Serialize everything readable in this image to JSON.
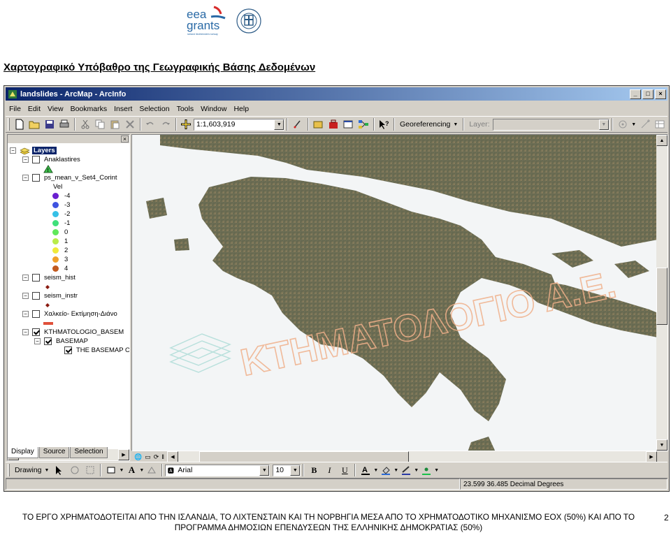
{
  "heading": "Χαρτογραφικό Υπόβαθρο της Γεωγραφικής Βάσης Δεδομένων",
  "logos": {
    "eea_line1": "eea",
    "eea_line2": "grants",
    "eea_tagline": "iceland liechtenstein norway"
  },
  "window": {
    "title": "landslides - ArcMap - ArcInfo",
    "controls": [
      "minimize-icon",
      "maximize-icon",
      "close-icon"
    ]
  },
  "menu": [
    "File",
    "Edit",
    "View",
    "Bookmarks",
    "Insert",
    "Selection",
    "Tools",
    "Window",
    "Help"
  ],
  "toolbar": {
    "scale_value": "1:1,603,919",
    "georeferencing_label": "Georeferencing",
    "layer_label": "Layer:",
    "layer_value": ""
  },
  "toc": {
    "root_label": "Layers",
    "layers": [
      {
        "label": "Anaklastires",
        "checked": false
      },
      {
        "label": "ps_mean_v_Set4_Corint",
        "checked": false,
        "field": "Vel"
      },
      {
        "label": "seism_hist",
        "checked": false
      },
      {
        "label": "seism_instr",
        "checked": false
      },
      {
        "label": "Χαλκείο- Εκτίμηση-Διάνο",
        "checked": false
      },
      {
        "label": "KTHMATOLOGIO_BASEM",
        "checked": true
      },
      {
        "label": "BASEMAP",
        "checked": true
      },
      {
        "label": "THE BASEMAP OI",
        "checked": true
      }
    ],
    "legend": [
      {
        "label": "-4",
        "color": "#6a1fd0"
      },
      {
        "label": "-3",
        "color": "#3f53e0"
      },
      {
        "label": "-2",
        "color": "#36c0e6"
      },
      {
        "label": "-1",
        "color": "#3fe07a"
      },
      {
        "label": "0",
        "color": "#5fe85a"
      },
      {
        "label": "1",
        "color": "#b9ec4a"
      },
      {
        "label": "2",
        "color": "#f0ea3a"
      },
      {
        "label": "3",
        "color": "#f0a02a"
      },
      {
        "label": "4",
        "color": "#c25a1e"
      }
    ],
    "tabs": [
      "Display",
      "Source",
      "Selection"
    ],
    "active_tab": "Display"
  },
  "map": {
    "watermark_text": "ΚΤΗΜΑΤΟΛΟΓΙΟ Α.Ε.",
    "land_color": "#6b6e58",
    "sea_color": "#f3f5f6"
  },
  "drawing_toolbar": {
    "drawing_label": "Drawing",
    "font_name": "Arial",
    "font_size": "10",
    "bold": "B",
    "italic": "I",
    "underline": "U",
    "text_tool": "A"
  },
  "status": {
    "coordinates": "23.599  36.485 Decimal Degrees"
  },
  "footer": {
    "line1": "ΤΟ ΕΡΓΟ ΧΡΗΜΑΤΟΔΟΤΕΙΤΑΙ ΑΠΟ ΤΗΝ ΙΣΛΑΝΔΙΑ, ΤΟ ΛΙΧΤΕΝΣΤΑΙΝ ΚΑΙ ΤΗ ΝΟΡΒΗΓΙΑ ΜΕΣΑ ΑΠΟ ΤΟ ΧΡΗΜΑΤΟΔΟΤΙΚΟ ΜΗΧΑΝΙΣΜΟ ΕΟΧ (50%) ΚΑΙ ΑΠΟ ΤΟ",
    "line2": "ΠΡΟΓΡΑΜΜΑ ΔΗΜΟΣΙΩΝ ΕΠΕΝΔΥΣΕΩΝ ΤΗΣ ΕΛΛΗΝΙΚΗΣ ΔΗΜΟΚΡΑΤΙΑΣ (50%)",
    "page_number": "2"
  }
}
